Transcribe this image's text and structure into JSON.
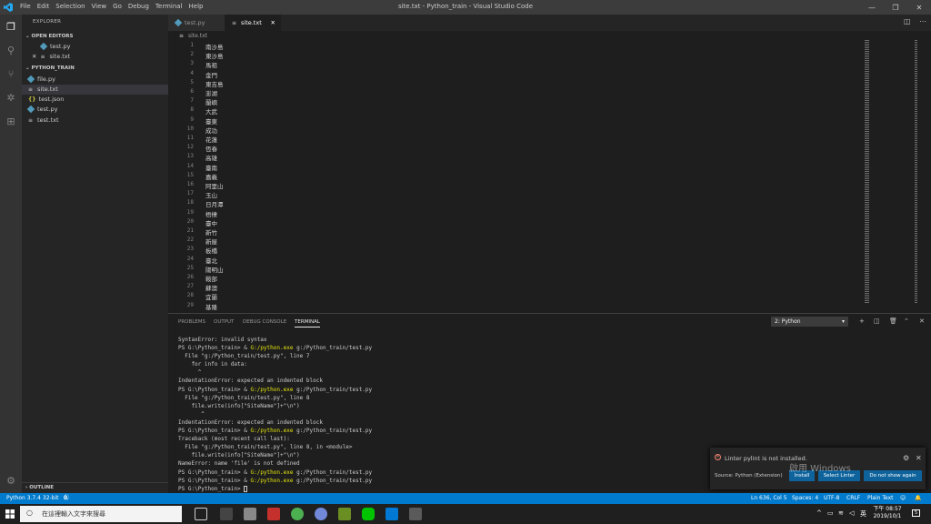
{
  "window": {
    "title": "site.txt - Python_train - Visual Studio Code",
    "menu": [
      "File",
      "Edit",
      "Selection",
      "View",
      "Go",
      "Debug",
      "Terminal",
      "Help"
    ]
  },
  "sidebar": {
    "header": "EXPLORER",
    "open_editors_label": "OPEN EDITORS",
    "open_editors": [
      {
        "name": "test.py",
        "type": "py"
      },
      {
        "name": "site.txt",
        "type": "txt"
      }
    ],
    "folder_label": "PYTHON_TRAIN",
    "files": [
      {
        "name": "file.py",
        "type": "py"
      },
      {
        "name": "site.txt",
        "type": "txt"
      },
      {
        "name": "test.json",
        "type": "json",
        "icon": "{}"
      },
      {
        "name": "test.py",
        "type": "py"
      },
      {
        "name": "test.txt",
        "type": "txt"
      }
    ],
    "outline_label": "OUTLINE"
  },
  "tabs": [
    {
      "label": "test.py"
    },
    {
      "label": "site.txt"
    }
  ],
  "breadcrumb": "site.txt",
  "editor": {
    "lines": [
      "南沙島",
      "東沙島",
      "馬祖",
      "金門",
      "東吉島",
      "澎湖",
      "蘭嶼",
      "大武",
      "臺東",
      "成功",
      "花蓮",
      "恆春",
      "高雄",
      "臺南",
      "嘉義",
      "阿里山",
      "玉山",
      "日月潭",
      "梧棲",
      "臺中",
      "新竹",
      "新屋",
      "板橋",
      "臺北",
      "陽明山",
      "鞍部",
      "蘇澳",
      "宜蘭",
      "基隆"
    ]
  },
  "panel": {
    "tabs": [
      "PROBLEMS",
      "OUTPUT",
      "DEBUG CONSOLE",
      "TERMINAL"
    ],
    "terminal_select": "2: Python",
    "terminal_lines": [
      {
        "text": "SyntaxError: invalid syntax"
      },
      {
        "prompt": "PS G:\\Python_train> & ",
        "exe": "G:/python.exe",
        "rest": " g:/Python_train/test.py"
      },
      {
        "text": "  File \"g:/Python_train/test.py\", line 7"
      },
      {
        "text": "    for info in data:"
      },
      {
        "text": "      ^"
      },
      {
        "text": "IndentationError: expected an indented block"
      },
      {
        "prompt": "PS G:\\Python_train> & ",
        "exe": "G:/python.exe",
        "rest": " g:/Python_train/test.py"
      },
      {
        "text": "  File \"g:/Python_train/test.py\", line 8"
      },
      {
        "text": "    file.write(info[\"SiteName\"]+\"\\n\")"
      },
      {
        "text": "       ^"
      },
      {
        "text": "IndentationError: expected an indented block"
      },
      {
        "prompt": "PS G:\\Python_train> & ",
        "exe": "G:/python.exe",
        "rest": " g:/Python_train/test.py"
      },
      {
        "text": "Traceback (most recent call last):"
      },
      {
        "text": "  File \"g:/Python_train/test.py\", line 8, in <module>"
      },
      {
        "text": "    file.write(info[\"SiteName\"]+\"\\n\")"
      },
      {
        "text": "NameError: name 'file' is not defined"
      },
      {
        "prompt": "PS G:\\Python_train> & ",
        "exe": "G:/python.exe",
        "rest": " g:/Python_train/test.py"
      },
      {
        "prompt": "PS G:\\Python_train> & ",
        "exe": "G:/python.exe",
        "rest": " g:/Python_train/test.py"
      },
      {
        "text": "PS G:\\Python_train> ",
        "cursor": true
      }
    ]
  },
  "notification": {
    "message": "Linter pylint is not installed.",
    "source": "Source: Python (Extension)",
    "buttons": [
      "Install",
      "Select Linter",
      "Do not show again"
    ],
    "watermark": "啟用 Windows"
  },
  "statusbar": {
    "interpreter": "Python 3.7.4 32-bit",
    "errors": "0",
    "warnings": "0",
    "position": "Ln 636, Col 5",
    "spaces": "Spaces: 4",
    "encoding": "UTF-8",
    "eol": "CRLF",
    "language": "Plain Text"
  },
  "taskbar": {
    "search_placeholder": "在這裡輸入文字來搜尋",
    "ime": "英",
    "time": "下午 08:57",
    "date": "2019/10/1",
    "notification_count": "5"
  },
  "colors": {
    "accent": "#007acc",
    "button": "#0e639c",
    "terminal_yellow": "#e5e510"
  }
}
